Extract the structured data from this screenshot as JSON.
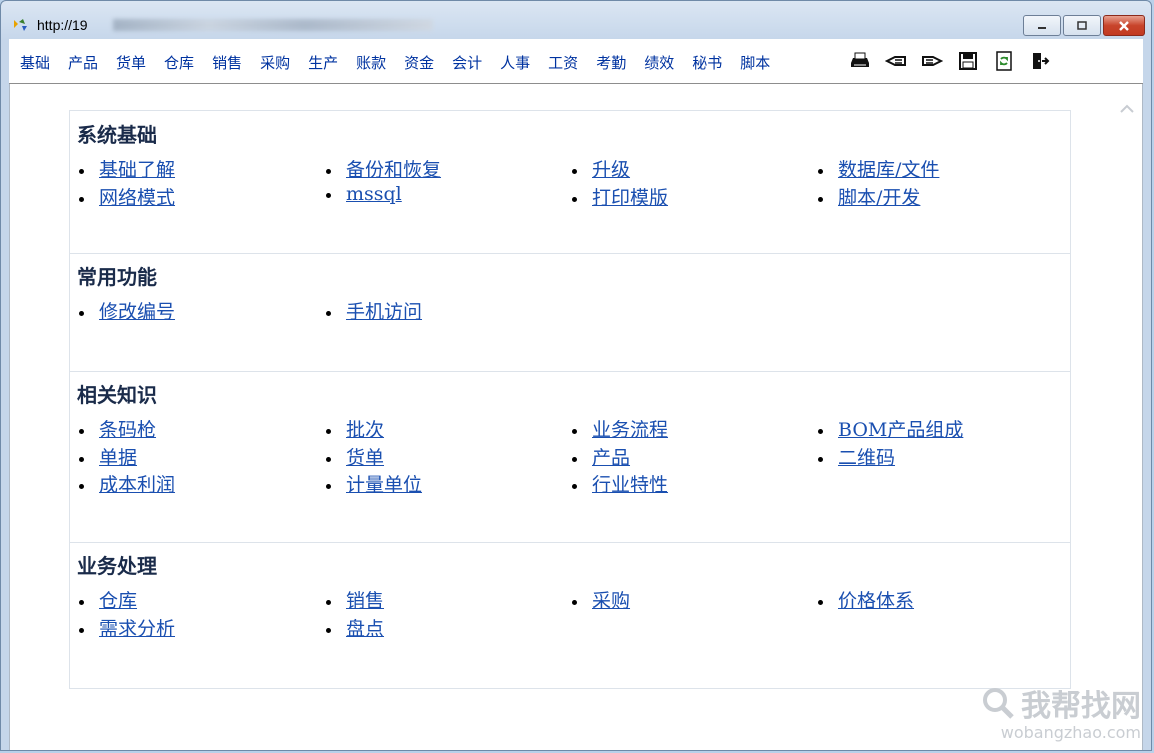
{
  "window": {
    "title": "http://19",
    "buttons": [
      "minimize",
      "maximize",
      "close"
    ]
  },
  "menubar": {
    "items": [
      "基础",
      "产品",
      "货单",
      "仓库",
      "销售",
      "采购",
      "生产",
      "账款",
      "资金",
      "会计",
      "人事",
      "工资",
      "考勤",
      "绩效",
      "秘书",
      "脚本"
    ],
    "tools": [
      "printer-icon",
      "hand-left-icon",
      "hand-right-icon",
      "save-icon",
      "refresh-icon",
      "exit-icon"
    ]
  },
  "sections": [
    {
      "title": "系统基础",
      "columns": [
        [
          "基础了解",
          "网络模式"
        ],
        [
          "备份和恢复",
          "mssql"
        ],
        [
          "升级",
          "打印模版"
        ],
        [
          "数据库/文件",
          "脚本/开发"
        ]
      ]
    },
    {
      "title": "常用功能",
      "columns": [
        [
          "修改编号"
        ],
        [
          "手机访问"
        ],
        [],
        []
      ]
    },
    {
      "title": "相关知识",
      "columns": [
        [
          "条码枪",
          "单据",
          "成本利润"
        ],
        [
          "批次",
          "货单",
          "计量单位"
        ],
        [
          "业务流程",
          "产品",
          "行业特性"
        ],
        [
          "BOM产品组成",
          "二维码"
        ]
      ]
    },
    {
      "title": "业务处理",
      "columns": [
        [
          "仓库",
          "需求分析"
        ],
        [
          "销售",
          "盘点"
        ],
        [
          "采购"
        ],
        [
          "价格体系"
        ]
      ]
    }
  ],
  "watermark": {
    "main": "我帮找网",
    "sub": "wobangzhao.com"
  },
  "colors": {
    "link": "#1a4fb0",
    "menu": "#0033a0",
    "heading": "#1a2b4a"
  }
}
